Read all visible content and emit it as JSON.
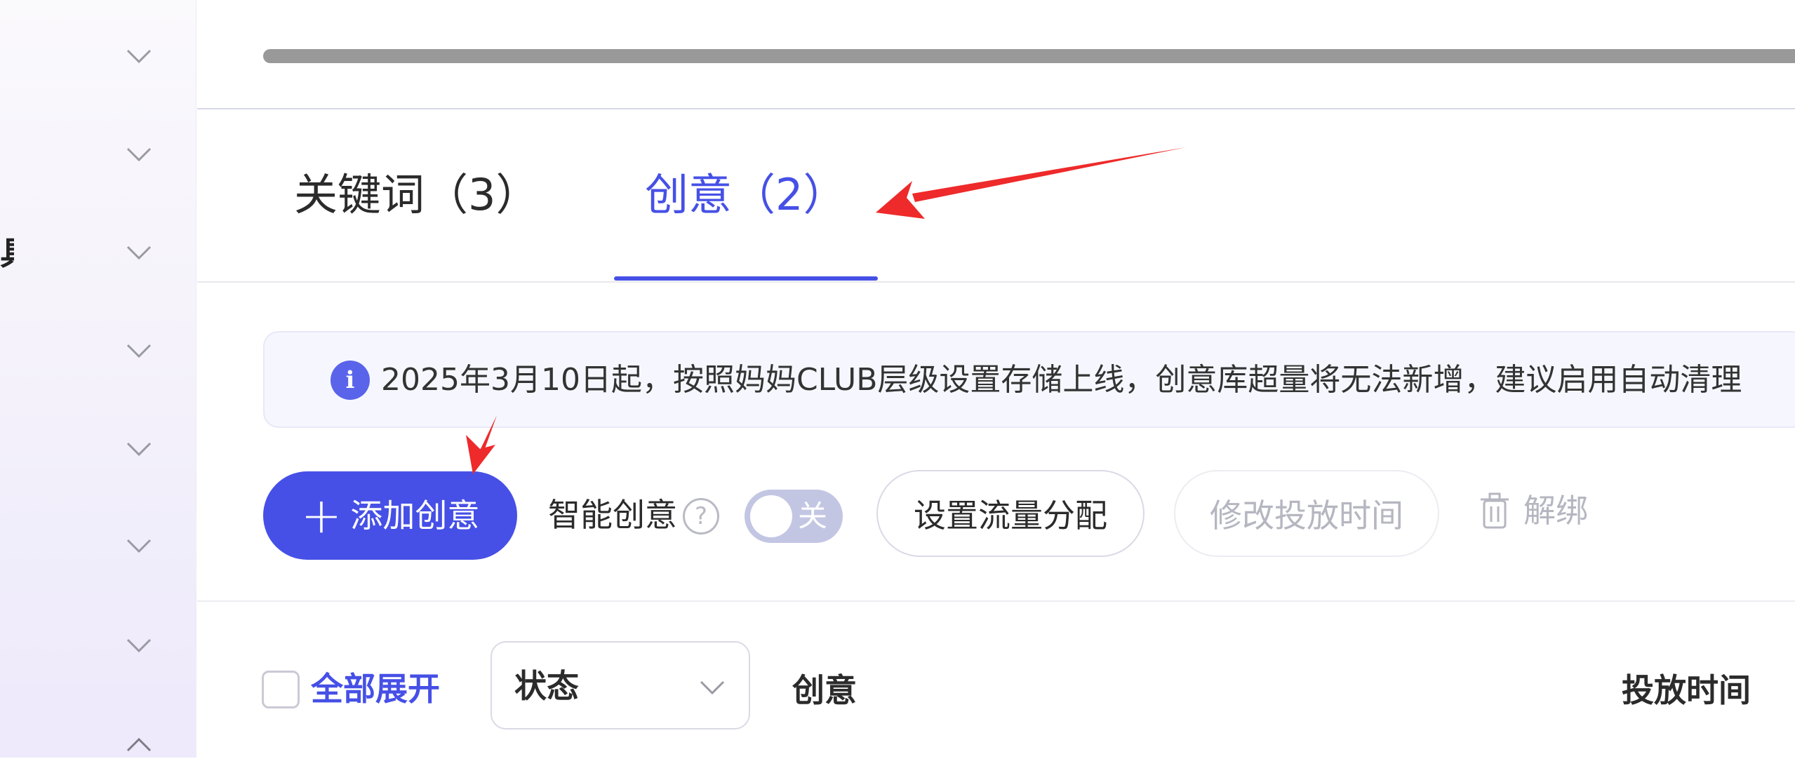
{
  "sidebar": {
    "items": [
      {
        "icon": "chevron-down-icon",
        "label": ""
      },
      {
        "icon": "chevron-down-icon",
        "label": ""
      },
      {
        "icon": "chevron-down-icon",
        "label": "具"
      },
      {
        "icon": "chevron-down-icon",
        "label": ""
      },
      {
        "icon": "chevron-down-icon",
        "label": ""
      },
      {
        "icon": "chevron-down-icon",
        "label": ""
      },
      {
        "icon": "chevron-down-icon",
        "label": ""
      },
      {
        "icon": "chevron-up-icon",
        "label": ""
      }
    ]
  },
  "tabs": [
    {
      "label": "关键词（3）",
      "active": false
    },
    {
      "label": "创意（2）",
      "active": true
    }
  ],
  "notice": {
    "icon": "info-icon",
    "text": "2025年3月10日起，按照妈妈CLUB层级设置存储上线，创意库超量将无法新增，建议启用自动清理"
  },
  "toolbar": {
    "add_label": "添加创意",
    "smart_label": "智能创意",
    "help_glyph": "?",
    "toggle_state": "关",
    "toggle_on": false,
    "flow_label": "设置流量分配",
    "time_label": "修改投放时间",
    "unbind_label": "解绑"
  },
  "table": {
    "expand_all": "全部展开",
    "status_value": "状态",
    "col_creative": "创意",
    "col_time": "投放时间"
  },
  "colors": {
    "accent": "#4650e6",
    "annotation_arrow": "#ee2a2a"
  }
}
